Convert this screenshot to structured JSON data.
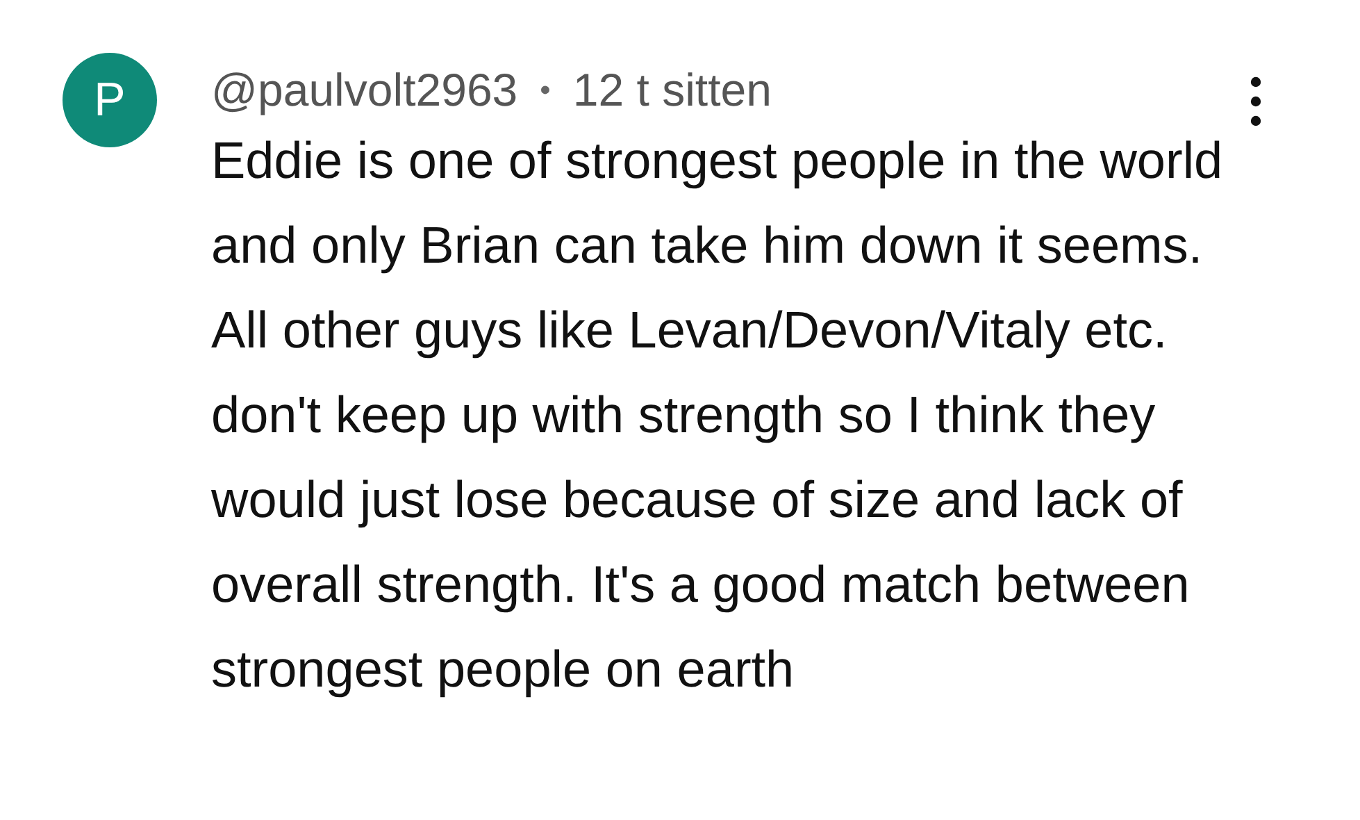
{
  "avatar": {
    "letter": "P",
    "color": "#0f8a78"
  },
  "comment": {
    "author": "@paulvolt2963",
    "separator": "•",
    "time": "12 t sitten",
    "text": "Eddie is one of strongest people in the world and only Brian can take him down it seems. All other guys like Levan/Devon/Vitaly etc. don't keep up with strength so I think they would just lose because of size and lack of overall strength. It's a good match between strongest people on earth"
  }
}
